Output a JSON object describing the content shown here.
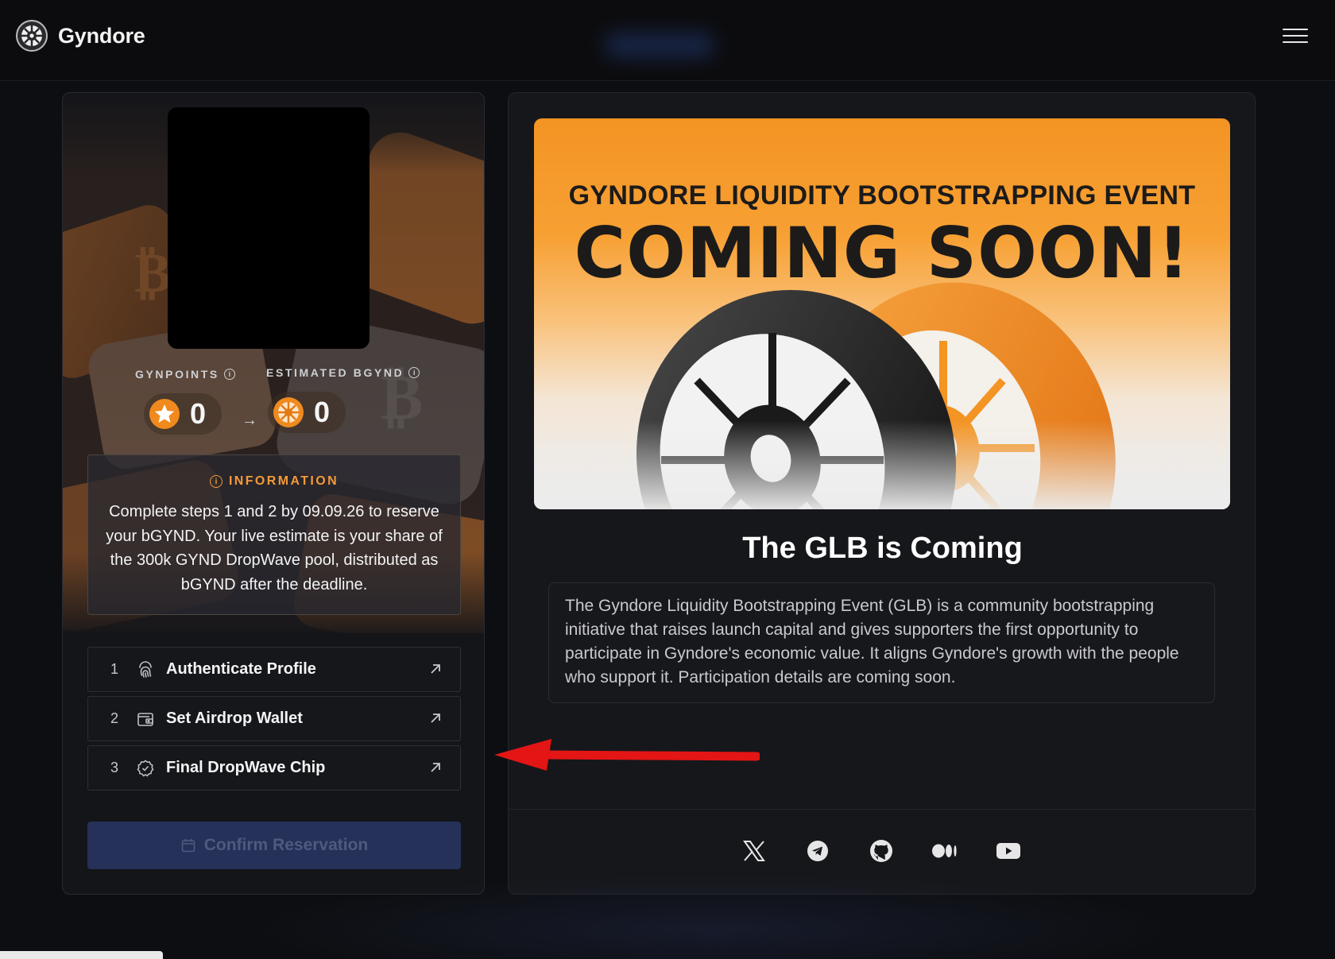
{
  "header": {
    "brand_name": "Gyndore",
    "menu_icon": "hamburger-menu-icon"
  },
  "points": {
    "gynpoints_label": "GYNPOINTS",
    "gynpoints_value": "0",
    "bgynd_label": "ESTIMATED BGYND",
    "bgynd_value": "0"
  },
  "information": {
    "title": "INFORMATION",
    "text": "Complete steps 1 and 2 by 09.09.26 to reserve your bGYND. Your live estimate is your share of the 300k GYND DropWave pool, distributed as bGYND after the deadline."
  },
  "steps": [
    {
      "num": "1",
      "label": "Authenticate Profile",
      "icon": "fingerprint-icon"
    },
    {
      "num": "2",
      "label": "Set Airdrop Wallet",
      "icon": "wallet-icon"
    },
    {
      "num": "3",
      "label": "Final DropWave Chip",
      "icon": "check-badge-icon"
    }
  ],
  "confirm_button": {
    "label": "Confirm Reservation",
    "icon": "calendar-icon"
  },
  "banner": {
    "subtitle": "GYNDORE LIQUIDITY BOOTSTRAPPING EVENT",
    "headline": "COMING SOON!"
  },
  "glb": {
    "title": "The GLB is Coming",
    "description": "The Gyndore Liquidity Bootstrapping Event (GLB) is a community bootstrapping initiative that raises launch capital and gives supporters the first opportunity to participate in Gyndore's economic value. It aligns Gyndore's growth with the people who support it. Participation details are coming soon."
  },
  "social": [
    "x-icon",
    "telegram-icon",
    "github-icon",
    "medium-icon",
    "youtube-icon"
  ],
  "colors": {
    "accent_orange": "#f39a3a",
    "background": "#0d0e11",
    "card": "#141519",
    "confirm_bg": "#253159",
    "annotation_red": "#e31515"
  }
}
